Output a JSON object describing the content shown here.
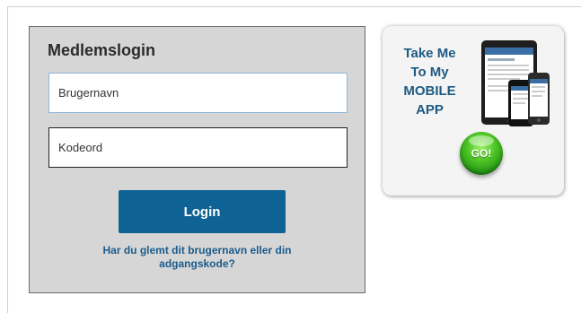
{
  "login": {
    "title": "Medlemslogin",
    "username_placeholder": "Brugernavn",
    "password_placeholder": "Kodeord",
    "button_label": "Login",
    "forgot_line1": "Har du glemt dit brugernavn eller din",
    "forgot_line2": "adgangskode?"
  },
  "mobile": {
    "line1": "Take Me",
    "line2": "To My",
    "line3": "MOBILE",
    "line4": "APP",
    "go_label": "GO!"
  },
  "colors": {
    "panel_bg": "#d6d6d6",
    "button_bg": "#0f6394",
    "link": "#1b5c8b",
    "mobile_text": "#1e5a83",
    "go_green": "#4cc524"
  }
}
